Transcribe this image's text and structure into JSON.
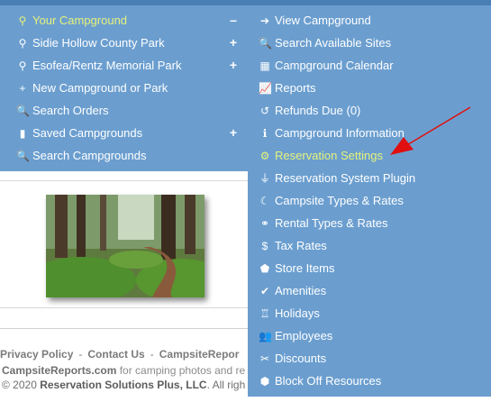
{
  "left_menu": {
    "items": [
      {
        "icon": "map-marker-icon",
        "glyph": "⚲",
        "label": "Your Campground",
        "trail": "–",
        "active": true
      },
      {
        "icon": "map-marker-icon",
        "glyph": "⚲",
        "label": "Sidie Hollow County Park",
        "trail": "+"
      },
      {
        "icon": "map-marker-icon",
        "glyph": "⚲",
        "label": "Esofea/Rentz Memorial Park",
        "trail": "+"
      },
      {
        "icon": "plus-icon",
        "glyph": "+",
        "label": "New Campground or Park",
        "trail": ""
      },
      {
        "icon": "search-icon",
        "glyph": "🔍",
        "label": "Search Orders",
        "trail": ""
      },
      {
        "icon": "bookmark-icon",
        "glyph": "▮",
        "label": "Saved Campgrounds",
        "trail": "+"
      },
      {
        "icon": "search-icon",
        "glyph": "🔍",
        "label": "Search Campgrounds",
        "trail": ""
      }
    ]
  },
  "right_menu": {
    "items": [
      {
        "icon": "arrow-right-icon",
        "glyph": "➔",
        "label": "View Campground"
      },
      {
        "icon": "search-icon",
        "glyph": "🔍",
        "label": "Search Available Sites"
      },
      {
        "icon": "calendar-icon",
        "glyph": "▦",
        "label": "Campground Calendar"
      },
      {
        "icon": "line-chart-icon",
        "glyph": "📈",
        "label": "Reports"
      },
      {
        "icon": "undo-icon",
        "glyph": "↺",
        "label": "Refunds Due (0)"
      },
      {
        "icon": "info-icon",
        "glyph": "ℹ",
        "label": "Campground Information"
      },
      {
        "icon": "gear-icon",
        "glyph": "⚙",
        "label": "Reservation Settings",
        "active": true
      },
      {
        "icon": "plug-icon",
        "glyph": "⏚",
        "label": "Reservation System Plugin"
      },
      {
        "icon": "moon-icon",
        "glyph": "☾",
        "label": "Campsite Types & Rates"
      },
      {
        "icon": "bicycle-icon",
        "glyph": "⚭",
        "label": "Rental Types & Rates"
      },
      {
        "icon": "dollar-icon",
        "glyph": "$",
        "label": "Tax Rates"
      },
      {
        "icon": "tags-icon",
        "glyph": "⬟",
        "label": "Store Items"
      },
      {
        "icon": "check-icon",
        "glyph": "✔",
        "label": "Amenities"
      },
      {
        "icon": "holiday-icon",
        "glyph": "♖",
        "label": "Holidays"
      },
      {
        "icon": "users-icon",
        "glyph": "👥",
        "label": "Employees"
      },
      {
        "icon": "scissors-icon",
        "glyph": "✂",
        "label": "Discounts"
      },
      {
        "icon": "cube-icon",
        "glyph": "⬢",
        "label": "Block Off Resources"
      }
    ]
  },
  "footer": {
    "link1": "Privacy Policy",
    "link2": "Contact Us",
    "link3": "CampsiteRepor",
    "line2_brand": "CampsiteReports.com",
    "line2_rest": " for camping photos and re",
    "line3_prefix": "© 2020 ",
    "line3_company": "Reservation Solutions Plus, LLC",
    "line3_rest": ". All righ"
  },
  "colors": {
    "menu_bg": "#6b9ecf",
    "active_text": "#e6f27a",
    "arrow": "#e01010"
  }
}
